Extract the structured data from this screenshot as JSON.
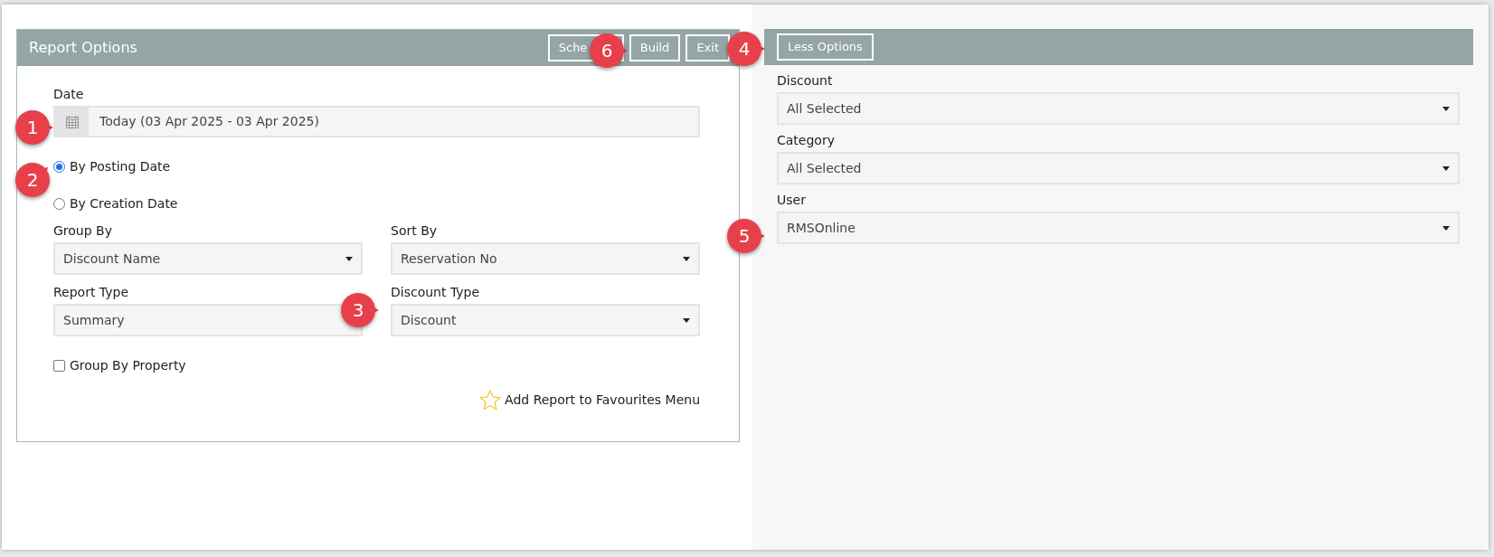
{
  "left_panel": {
    "title": "Report Options",
    "buttons": [
      "Sche",
      "Build",
      "Exit"
    ],
    "date": {
      "label": "Date",
      "value": "Today (03 Apr 2025 - 03 Apr 2025)"
    },
    "date_basis": [
      {
        "label": "By Posting Date",
        "selected": true
      },
      {
        "label": "By Creation Date",
        "selected": false
      }
    ],
    "selects": [
      {
        "label": "Group By",
        "value": "Discount Name",
        "has_caret": true
      },
      {
        "label": "Sort By",
        "value": "Reservation No",
        "has_caret": true
      },
      {
        "label": "Report Type",
        "value": "Summary"
      },
      {
        "label": "Discount Type",
        "value": "Discount",
        "has_caret": true
      }
    ],
    "group_by_property": {
      "label": "Group By Property",
      "checked": false
    },
    "favourites_link": "Add Report to Favourites Menu"
  },
  "right_panel": {
    "button": "Less Options",
    "selects": [
      {
        "label": "Discount",
        "value": "All Selected"
      },
      {
        "label": "Category",
        "value": "All Selected"
      },
      {
        "label": "User",
        "value": "RMSOnline"
      }
    ]
  },
  "callouts": [
    {
      "number": "1"
    },
    {
      "number": "2"
    },
    {
      "number": "3"
    },
    {
      "number": "4"
    },
    {
      "number": "5"
    },
    {
      "number": "6"
    }
  ]
}
